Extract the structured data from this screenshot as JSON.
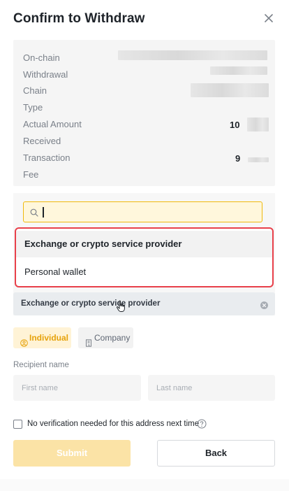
{
  "dialog": {
    "title": "Confirm to Withdraw"
  },
  "summary": {
    "on_chain": {
      "label_line1": "On-chain",
      "label_line2": "Withdrawal"
    },
    "chain_type": {
      "label_line1": "Chain",
      "label_line2": "Type"
    },
    "amount": {
      "label_line1": "Actual Amount",
      "label_line2": "Received",
      "value_visible": "10"
    },
    "fee": {
      "label_line1": "Transaction",
      "label_line2": "Fee",
      "value_visible": "9"
    }
  },
  "search": {
    "value": "",
    "placeholder": ""
  },
  "options": [
    {
      "label": "Exchange or crypto service provider"
    },
    {
      "label": "Personal wallet"
    }
  ],
  "selected_provider": "Exchange or crypto service provider",
  "recipient_type": {
    "individual": "Individual",
    "company": "Company"
  },
  "recipient": {
    "label": "Recipient name",
    "first_placeholder": "First name",
    "last_placeholder": "Last name"
  },
  "verification_checkbox": "No verification needed for this address next time",
  "buttons": {
    "submit": "Submit",
    "back": "Back"
  },
  "colors": {
    "accent": "#f0b90b",
    "highlight_border": "#e8404a",
    "submit_disabled": "#fbe3a6"
  },
  "icons": [
    "close-icon",
    "search-icon",
    "clear-icon",
    "user-circle-icon",
    "building-icon",
    "help-icon",
    "pointer-hand-icon"
  ]
}
